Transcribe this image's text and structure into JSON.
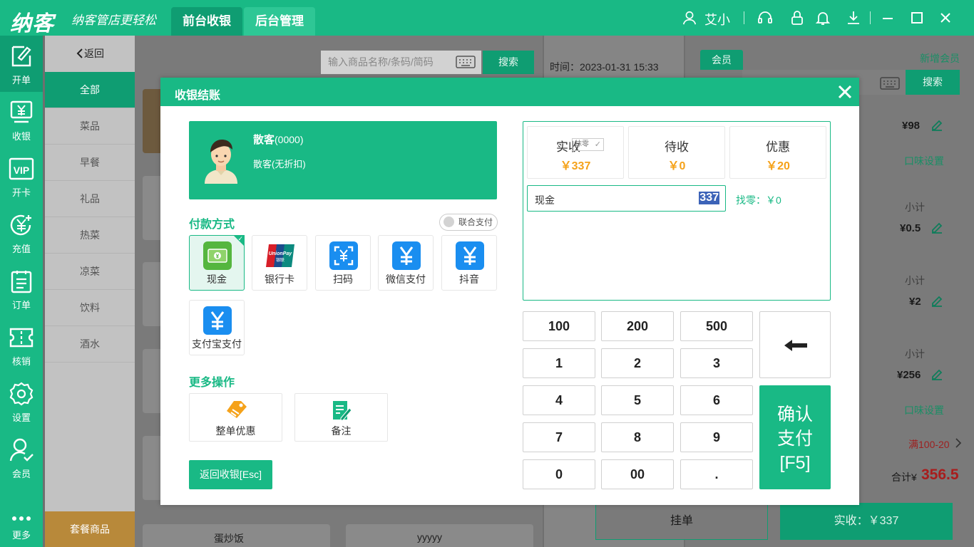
{
  "topbar": {
    "logo": "纳客",
    "slogan": "纳客管店更轻松",
    "tabs": [
      {
        "label": "前台收银"
      },
      {
        "label": "后台管理"
      }
    ],
    "username": "艾小"
  },
  "sidebar": {
    "items": [
      {
        "label": "开单",
        "icon": "edit-icon"
      },
      {
        "label": "收银",
        "icon": "cashier-icon"
      },
      {
        "label": "开卡",
        "icon": "vip-card-icon"
      },
      {
        "label": "充值",
        "icon": "recharge-icon"
      },
      {
        "label": "订单",
        "icon": "order-list-icon"
      },
      {
        "label": "核销",
        "icon": "ticket-icon"
      },
      {
        "label": "设置",
        "icon": "gear-icon"
      },
      {
        "label": "会员",
        "icon": "member-icon"
      },
      {
        "label": "更多",
        "icon": "more-dots-icon"
      }
    ]
  },
  "categories": {
    "back": "返回",
    "items": [
      "全部",
      "菜品",
      "早餐",
      "礼品",
      "热菜",
      "凉菜",
      "饮料",
      "酒水"
    ],
    "combo": "套餐商品"
  },
  "products": {
    "search_placeholder": "输入商品名称/条码/简码",
    "search_button": "搜索",
    "visible_names": [
      "蛋炒饭",
      "yyyyy"
    ]
  },
  "order": {
    "time": "时间：2023-01-31 15:33"
  },
  "right": {
    "member_tab": "会员",
    "new_member": "新增会员",
    "search_button": "搜索",
    "prices": [
      "¥98",
      "¥0.5",
      "¥2",
      "¥256"
    ],
    "subtotal_label": "小计",
    "taste_setting": "口味设置",
    "promo": "满100-20",
    "total_label": "合计¥",
    "total_value": "356.5",
    "hang_button": "挂单",
    "pay_button": "实收：￥337"
  },
  "modal": {
    "title": "收银结账",
    "customer": {
      "name": "散客",
      "code": "(0000)",
      "sub": "散客(无折扣)"
    },
    "payment_section": "付款方式",
    "joint_pay": "联合支付",
    "payment_methods": [
      {
        "label": "现金",
        "icon": "cash-icon"
      },
      {
        "label": "银行卡",
        "icon": "unionpay-icon"
      },
      {
        "label": "扫码",
        "icon": "scan-yen-icon"
      },
      {
        "label": "微信支付",
        "icon": "yen-icon"
      },
      {
        "label": "抖音",
        "icon": "yen-icon"
      },
      {
        "label": "支付宝支付",
        "icon": "yen-icon"
      }
    ],
    "more_section": "更多操作",
    "more_actions": [
      {
        "label": "整单优惠",
        "icon": "discount-tag-icon"
      },
      {
        "label": "备注",
        "icon": "note-edit-icon"
      }
    ],
    "esc_button": "返回收银[Esc]",
    "summary": {
      "paid_label": "实收",
      "moling": "抹零",
      "paid_value": "￥337",
      "pending_label": "待收",
      "pending_value": "￥0",
      "discount_label": "优惠",
      "discount_value": "￥20"
    },
    "cash_label": "现金",
    "cash_value": "337",
    "change": "找零：￥0",
    "keys": [
      "100",
      "200",
      "500",
      "1",
      "2",
      "3",
      "4",
      "5",
      "6",
      "7",
      "8",
      "9",
      "0",
      "00",
      "."
    ],
    "confirm": {
      "line1": "确认",
      "line2": "支付",
      "line3": "[F5]"
    }
  },
  "colors": {
    "primary": "#19b985",
    "primary_dark": "#0f9d72",
    "amount_orange": "#f5a21a",
    "total_red": "#c0392b"
  }
}
